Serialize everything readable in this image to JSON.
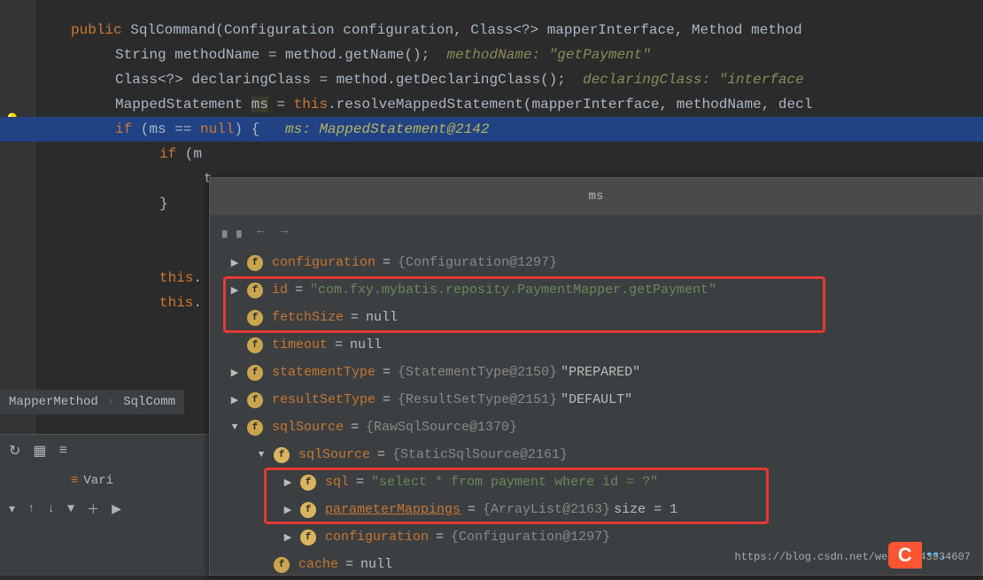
{
  "code": {
    "l1_kw": "public",
    "l1_rest": " SqlCommand(Configuration configuration, Class<?> mapperInterface, Method method",
    "l2_a": "String methodName = method.getName();",
    "l2_hint": "  methodName: \"getPayment\"",
    "l3_a": "Class<?> declaringClass = method.getDeclaringClass();",
    "l3_hint": "  declaringClass: \"interface",
    "l4_a": "MappedStatement ",
    "l4_var": "ms",
    "l4_b": " = ",
    "l4_kw": "this",
    "l4_c": ".resolveMappedStatement(mapperInterface, methodName, decl",
    "l5_kw": "if",
    "l5_a": " (ms == ",
    "l5_null": "null",
    "l5_b": ") {",
    "l5_hint": "   ms: MappedStatement@2142",
    "l6_kw": "if",
    "l6_a": " (m",
    "l7": "t",
    "l8": "}",
    "l9_kw": "this",
    "l9_a": ".",
    "l10_kw": "this",
    "l10_a": "."
  },
  "breadcrumb": {
    "a": "MapperMethod",
    "b": "SqlComm"
  },
  "vars_label": "Vari",
  "popup": {
    "title": "ms",
    "rows": [
      {
        "d": 0,
        "arrow": "right",
        "name": "configuration",
        "val": "{Configuration@1297}",
        "vtype": "obj"
      },
      {
        "d": 0,
        "arrow": "right",
        "name": "id",
        "val": "\"com.fxy.mybatis.reposity.PaymentMapper.getPayment\"",
        "vtype": "str"
      },
      {
        "d": 0,
        "arrow": "",
        "name": "fetchSize",
        "val": "null",
        "vtype": "null"
      },
      {
        "d": 0,
        "arrow": "",
        "name": "timeout",
        "val": "null",
        "vtype": "null"
      },
      {
        "d": 0,
        "arrow": "right",
        "name": "statementType",
        "val": "{StatementType@2150}",
        "vtype": "obj",
        "extra": " \"PREPARED\""
      },
      {
        "d": 0,
        "arrow": "right",
        "name": "resultSetType",
        "val": "{ResultSetType@2151}",
        "vtype": "obj",
        "extra": " \"DEFAULT\""
      },
      {
        "d": 0,
        "arrow": "down",
        "name": "sqlSource",
        "val": "{RawSqlSource@1370}",
        "vtype": "obj"
      },
      {
        "d": 1,
        "arrow": "down",
        "name": "sqlSource",
        "val": "{StaticSqlSource@2161}",
        "vtype": "obj",
        "lit": true
      },
      {
        "d": 2,
        "arrow": "right",
        "name": "sql",
        "val": "\"select * from payment where id = ?\"",
        "vtype": "str",
        "lit": true
      },
      {
        "d": 2,
        "arrow": "right",
        "name": "parameterMappings",
        "u": true,
        "val": "{ArrayList@2163}",
        "vtype": "obj",
        "extra": "  size = 1",
        "lit": true
      },
      {
        "d": 2,
        "arrow": "right",
        "name": "configuration",
        "val": "{Configuration@1297}",
        "vtype": "obj",
        "lit": true
      },
      {
        "d": 1,
        "arrow": "",
        "name": "cache",
        "val": "null",
        "vtype": "null"
      }
    ]
  },
  "watermark": "https://blog.csdn.net/weixin_43934607",
  "csdn": "C"
}
